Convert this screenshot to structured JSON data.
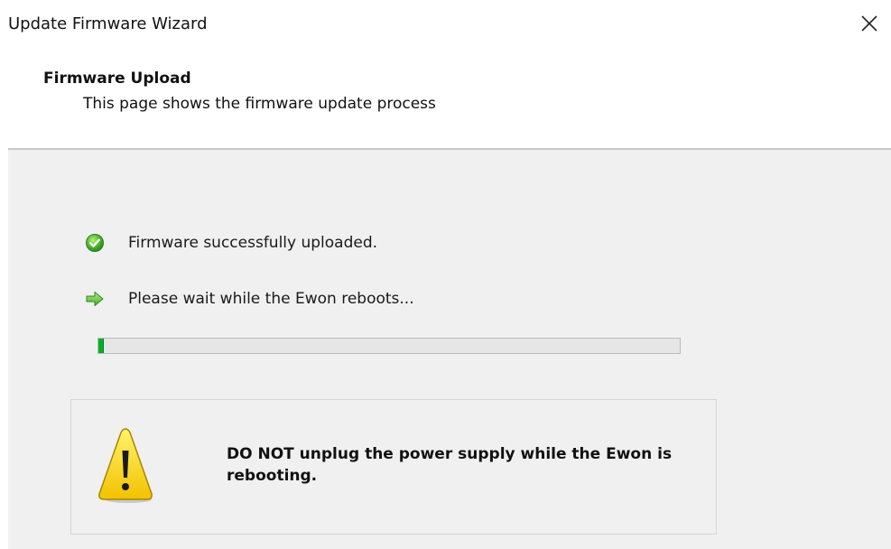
{
  "window": {
    "title": "Update Firmware Wizard"
  },
  "header": {
    "title": "Firmware Upload",
    "subtitle": "This page shows the firmware update process"
  },
  "status": {
    "items": [
      {
        "icon": "check-circle-icon",
        "label": "Firmware successfully uploaded."
      },
      {
        "icon": "arrow-right-icon",
        "label": "Please wait while the Ewon reboots..."
      }
    ]
  },
  "progress": {
    "percent": 1,
    "fill_color": "#06b025"
  },
  "warning": {
    "icon": "warning-icon",
    "message": "DO NOT unplug the power supply while the Ewon is rebooting."
  }
}
